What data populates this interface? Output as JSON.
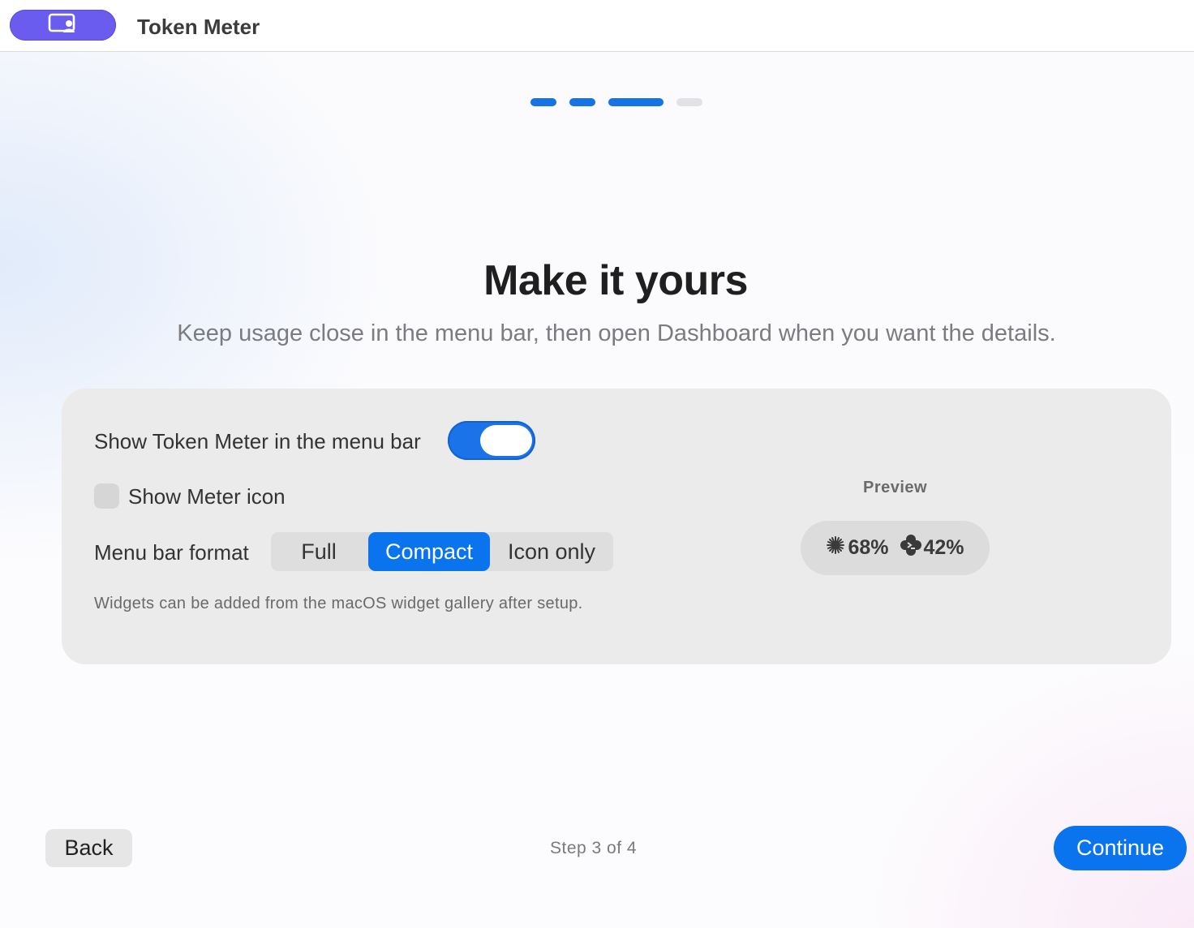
{
  "titlebar": {
    "app_icon": "screen-person-icon",
    "title": "Token Meter"
  },
  "progress": {
    "total_steps": 4,
    "current_step": 3
  },
  "main": {
    "headline": "Make it yours",
    "subheadline": "Keep usage close in the menu bar, then open Dashboard when you want the details."
  },
  "settings": {
    "show_in_menu_bar_label": "Show Token Meter in the menu bar",
    "show_in_menu_bar_on": true,
    "show_meter_icon_label": "Show Meter icon",
    "show_meter_icon_checked": false,
    "menu_bar_format_label": "Menu bar format",
    "format_options": [
      "Full",
      "Compact",
      "Icon only"
    ],
    "format_selected": "Compact",
    "footnote": "Widgets can be added from the macOS widget gallery after setup."
  },
  "preview": {
    "label": "Preview",
    "items": [
      {
        "icon": "starburst-icon",
        "value": "68%"
      },
      {
        "icon": "flower-badge-icon",
        "value": "42%"
      }
    ]
  },
  "footer": {
    "back_label": "Back",
    "step_text": "Step 3 of 4",
    "continue_label": "Continue"
  },
  "colors": {
    "accent": "#0a73ee",
    "app_pill": "#6b5cf0"
  }
}
